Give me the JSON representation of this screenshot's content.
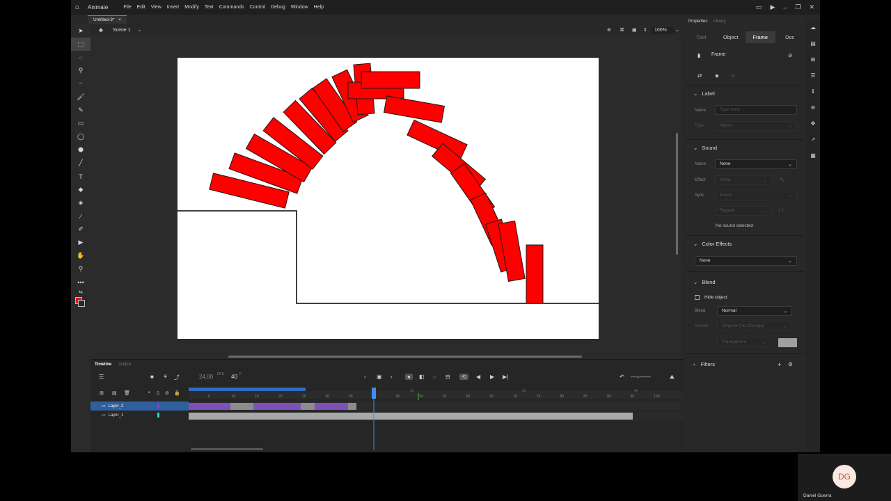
{
  "app": {
    "name": "Animate",
    "menu": [
      "File",
      "Edit",
      "View",
      "Insert",
      "Modify",
      "Text",
      "Commands",
      "Control",
      "Debug",
      "Window",
      "Help"
    ]
  },
  "document": {
    "tab_label": "Untitled-3*",
    "close_glyph": "×"
  },
  "stage_bar": {
    "scene_label": "Scene 1",
    "zoom": "100%"
  },
  "timeline": {
    "tabs": [
      "Timeline",
      "Output"
    ],
    "fps": "24,00",
    "fps_unit": "FPS",
    "current_frame": "40",
    "frame_unit": "F",
    "ruler_labels": [
      "5",
      "10",
      "15",
      "20",
      "25",
      "30",
      "35",
      "45",
      "50",
      "55",
      "60",
      "65",
      "70",
      "75",
      "80",
      "85",
      "90",
      "95",
      "100"
    ],
    "time_marks": [
      "2s",
      "3s",
      "4s"
    ],
    "layers": [
      {
        "name": "Layer_2",
        "selected": true,
        "color": "#8a3fd6"
      },
      {
        "name": "Layer_1",
        "selected": false,
        "color": "#1ed8e0"
      }
    ]
  },
  "properties": {
    "header_tabs": [
      "Properties",
      "Library"
    ],
    "tabs": [
      "Tool",
      "Object",
      "Frame",
      "Doc"
    ],
    "active_tab": "Frame",
    "frame_title": "Frame",
    "label_section": {
      "title": "Label",
      "name_label": "Name",
      "name_placeholder": "Type here",
      "type_label": "Type",
      "type_value": "Name"
    },
    "sound_section": {
      "title": "Sound",
      "name_label": "Name",
      "name_value": "None",
      "effect_label": "Effect",
      "effect_value": "None",
      "sync_label": "Sync",
      "sync_value": "Event",
      "repeat_value": "Repeat",
      "repeat_count": "x 1",
      "status": "No sound selected"
    },
    "color_effects": {
      "title": "Color Effects",
      "value": "None"
    },
    "blend": {
      "title": "Blend",
      "hide_object": "Hide object",
      "blend_label": "Blend",
      "blend_value": "Normal",
      "render_label": "Render",
      "render_value": "Original (No Change)",
      "transparent_value": "Transparent"
    },
    "filters": {
      "title": "Filters"
    }
  },
  "user": {
    "initials": "DG",
    "name": "Daniel Guerra"
  },
  "colors": {
    "accent": "#3f8ef0",
    "shape_red": "#ff0000",
    "stroke_color": "#ff0000"
  }
}
